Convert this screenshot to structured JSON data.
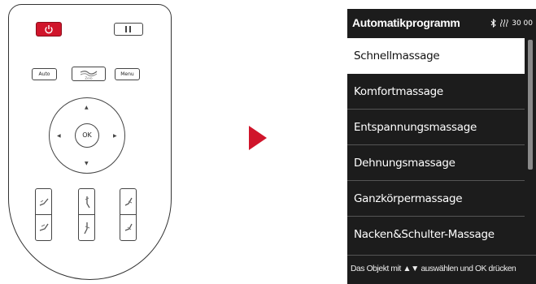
{
  "remote": {
    "auto_label": "Auto",
    "zero_label": "Zero",
    "menu_label": "Menu",
    "ok_label": "OK",
    "power_color": "#d0152b"
  },
  "screen": {
    "title": "Automatikprogramm",
    "status_bluetooth_icon": "bluetooth-icon",
    "status_heat_icon": "heat-icon",
    "timer": "30 00",
    "items": [
      {
        "label": "Schnellmassage",
        "selected": true
      },
      {
        "label": "Komfortmassage",
        "selected": false
      },
      {
        "label": "Entspannungsmassage",
        "selected": false
      },
      {
        "label": "Dehnungsmassage",
        "selected": false
      },
      {
        "label": "Ganzkörpermassage",
        "selected": false
      },
      {
        "label": "Nacken&Schulter-Massage",
        "selected": false
      }
    ],
    "footer_pre": "Das Objekt mit ",
    "footer_arrows": "▲▼",
    "footer_post": " auswählen und OK drücken"
  },
  "colors": {
    "screen_bg": "#1c1c1c",
    "arrow": "#d0152b"
  }
}
